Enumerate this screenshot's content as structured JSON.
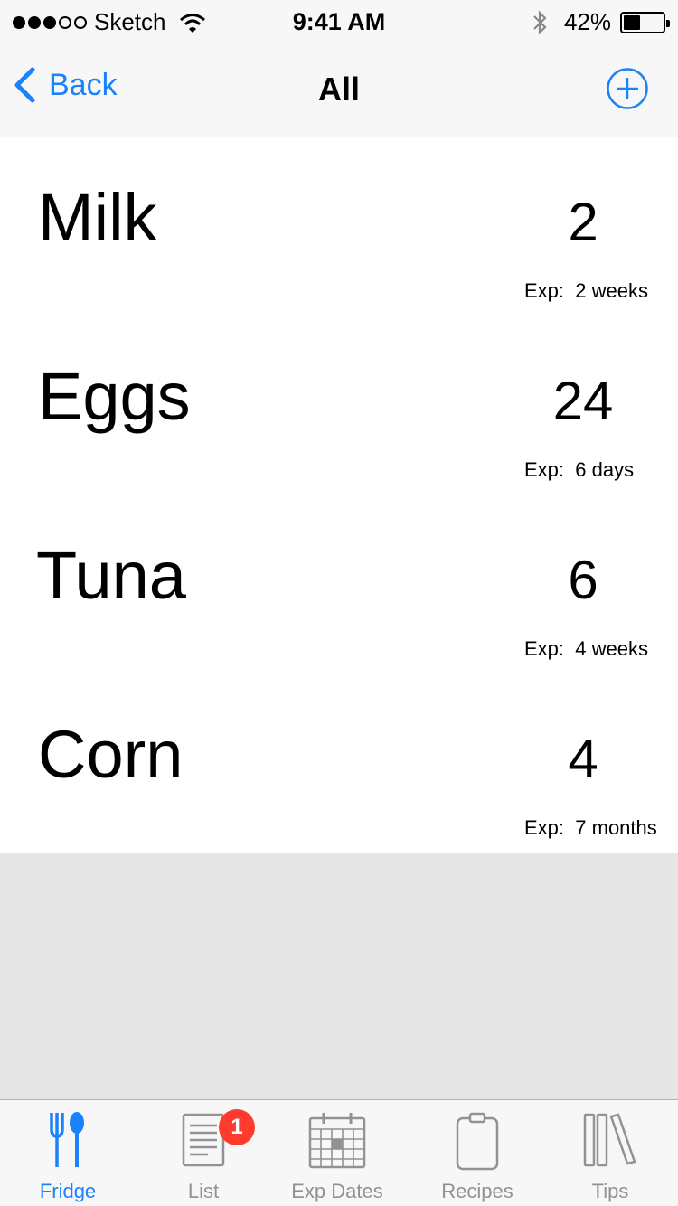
{
  "status_bar": {
    "carrier": "Sketch",
    "time": "9:41 AM",
    "battery_percent": "42%",
    "battery_level": 0.42,
    "signal_strength": 3,
    "signal_max": 5
  },
  "nav": {
    "back_label": "Back",
    "title": "All",
    "add_icon": "plus-circle-icon",
    "accent_color": "#1a82fb"
  },
  "items": [
    {
      "name": "Milk",
      "quantity": "2",
      "exp_label": "Exp:",
      "exp_value": "2 weeks"
    },
    {
      "name": "Eggs",
      "quantity": "24",
      "exp_label": "Exp:",
      "exp_value": "6 days"
    },
    {
      "name": "Tuna",
      "quantity": "6",
      "exp_label": "Exp:",
      "exp_value": "4 weeks"
    },
    {
      "name": "Corn",
      "quantity": "4",
      "exp_label": "Exp:",
      "exp_value": "7 months"
    }
  ],
  "tabs": [
    {
      "label": "Fridge",
      "icon": "fork-spoon-icon",
      "active": true
    },
    {
      "label": "List",
      "icon": "list-icon",
      "badge": "1"
    },
    {
      "label": "Exp Dates",
      "icon": "calendar-icon"
    },
    {
      "label": "Recipes",
      "icon": "clipboard-icon"
    },
    {
      "label": "Tips",
      "icon": "books-icon"
    }
  ]
}
